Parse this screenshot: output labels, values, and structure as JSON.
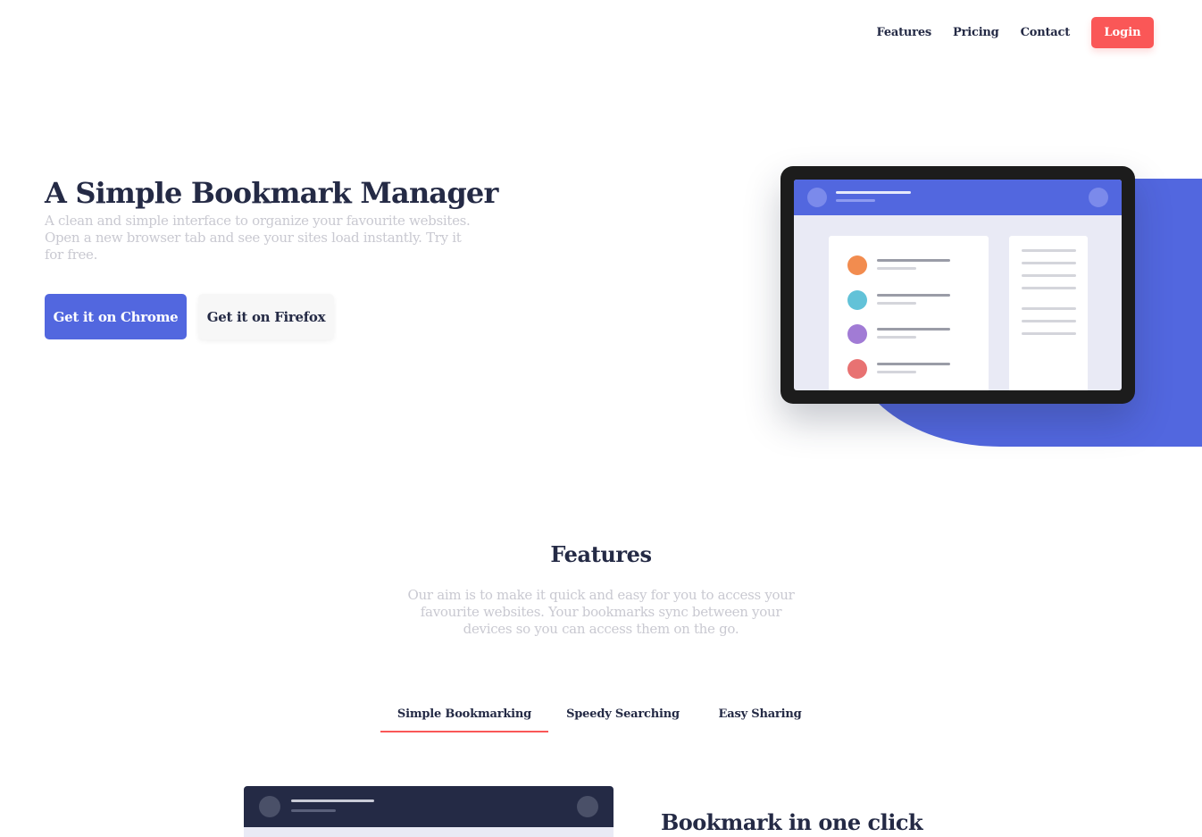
{
  "nav": {
    "links": [
      "Features",
      "Pricing",
      "Contact"
    ],
    "login_label": "Login"
  },
  "hero": {
    "title": "A Simple Bookmark Manager",
    "description": "A clean and simple interface to organize your favourite websites. Open a new browser tab and see your sites load instantly. Try it for free.",
    "chrome_button": "Get it on Chrome",
    "firefox_button": "Get it on Firefox"
  },
  "features": {
    "title": "Features",
    "description": "Our aim is to make it quick and easy for you to access your favourite websites. Your bookmarks sync between your devices so you can access them on the go.",
    "tabs": [
      "Simple Bookmarking",
      "Speedy Searching",
      "Easy Sharing"
    ],
    "active_tab": "Simple Bookmarking",
    "feature_heading": "Bookmark in one click"
  },
  "colors": {
    "primary_blue": "#5267df",
    "soft_red": "#fa5757",
    "dark_navy": "#242a45",
    "grayish_text": "#c9c9d1",
    "dot_orange": "#f28c4f",
    "dot_teal": "#62c2d8",
    "dot_purple": "#a17bd5",
    "dot_red": "#e87272"
  },
  "icons": {
    "tablet_illustration": "tablet-bookmark-illustration",
    "feature_illustration": "bookmark-app-illustration"
  }
}
